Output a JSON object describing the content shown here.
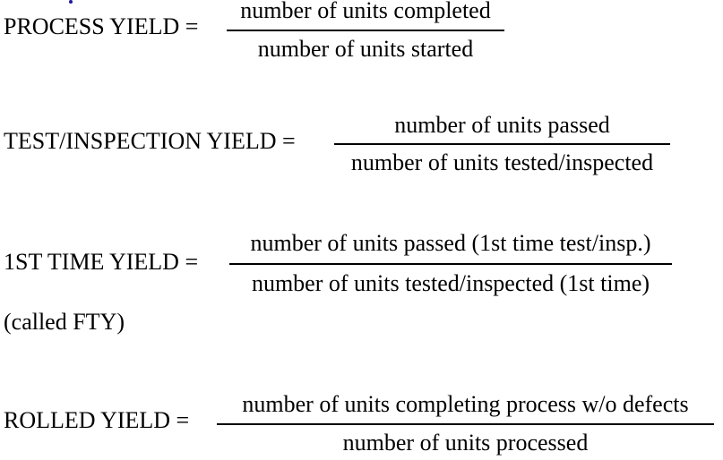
{
  "formulas": [
    {
      "label": "PROCESS YIELD =",
      "numerator": "number of units completed",
      "denominator": "number of units started"
    },
    {
      "label": "TEST/INSPECTION YIELD =",
      "numerator": "number of units passed",
      "denominator": "number of units tested/inspected"
    },
    {
      "label": "1ST TIME YIELD  =",
      "numerator": "number of units passed (1st time test/insp.)",
      "denominator": "number of units tested/inspected (1st time)",
      "note": "(called FTY)"
    },
    {
      "label": "ROLLED YIELD =",
      "numerator": "number of units completing process  w/o defects",
      "denominator": "number of units processed"
    }
  ]
}
